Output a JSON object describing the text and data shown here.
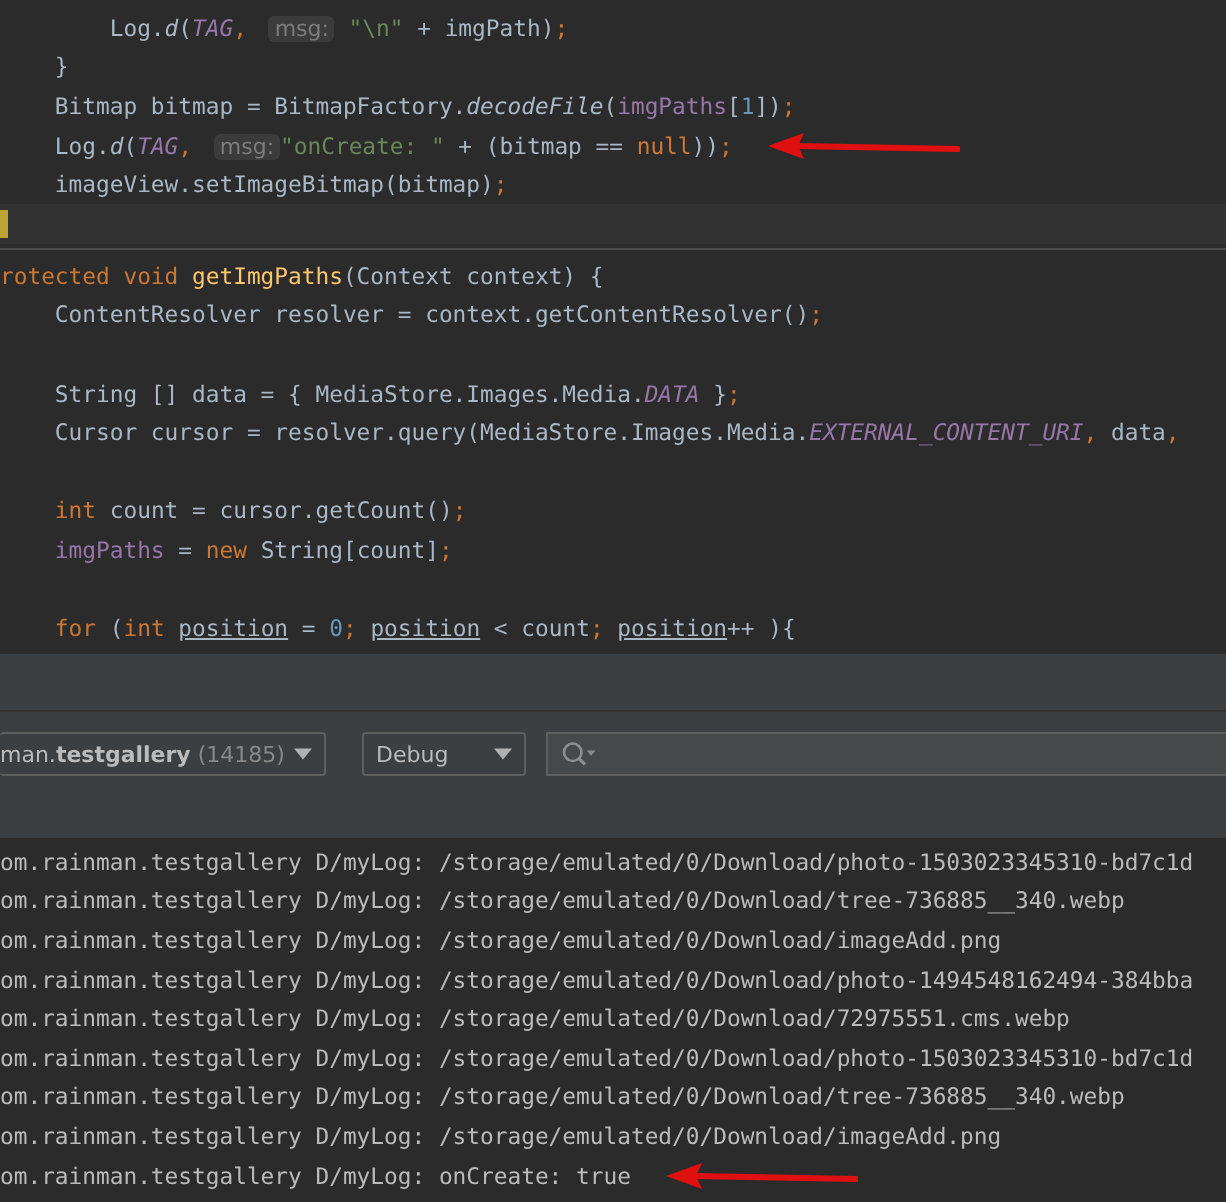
{
  "editor_top": {
    "lines": [
      {
        "marked": false,
        "current": false,
        "tokens": [
          {
            "text": "        Log.",
            "kind": "plain"
          },
          {
            "text": "d",
            "kind": "static_method"
          },
          {
            "text": "(",
            "kind": "plain"
          },
          {
            "text": "TAG",
            "kind": "static_field"
          },
          {
            "text": ", ",
            "kind": "keyword"
          },
          {
            "text": "msg:",
            "kind": "hint"
          },
          {
            "text": " \"\\n\"",
            "kind": "string"
          },
          {
            "text": " + imgPath)",
            "kind": "plain"
          },
          {
            "text": ";",
            "kind": "keyword"
          }
        ]
      },
      {
        "marked": false,
        "current": false,
        "tokens": [
          {
            "text": "    }",
            "kind": "plain"
          }
        ]
      },
      {
        "marked": false,
        "current": false,
        "tokens": [
          {
            "text": "    Bitmap bitmap = BitmapFactory.",
            "kind": "plain"
          },
          {
            "text": "decodeFile",
            "kind": "static_method"
          },
          {
            "text": "(",
            "kind": "plain"
          },
          {
            "text": "imgPaths",
            "kind": "field"
          },
          {
            "text": "[",
            "kind": "plain"
          },
          {
            "text": "1",
            "kind": "number"
          },
          {
            "text": "])",
            "kind": "plain"
          },
          {
            "text": ";",
            "kind": "keyword"
          }
        ]
      },
      {
        "marked": true,
        "current": false,
        "tokens": [
          {
            "text": "    Log.",
            "kind": "plain"
          },
          {
            "text": "d",
            "kind": "static_method"
          },
          {
            "text": "(",
            "kind": "plain"
          },
          {
            "text": "TAG",
            "kind": "static_field"
          },
          {
            "text": ", ",
            "kind": "keyword"
          },
          {
            "text": "msg:",
            "kind": "hint"
          },
          {
            "text": "\"onCreate: \"",
            "kind": "string"
          },
          {
            "text": " + (bitmap == ",
            "kind": "plain"
          },
          {
            "text": "null",
            "kind": "keyword"
          },
          {
            "text": "))",
            "kind": "plain"
          },
          {
            "text": ";",
            "kind": "keyword"
          }
        ]
      },
      {
        "marked": false,
        "current": false,
        "tokens": [
          {
            "text": "    imageView.setImageBitmap(bitmap)",
            "kind": "plain"
          },
          {
            "text": ";",
            "kind": "keyword"
          }
        ]
      },
      {
        "marked": false,
        "current": true
      }
    ]
  },
  "editor_bottom": {
    "lines": [
      {
        "marked": false,
        "current": false,
        "tokens": [
          {
            "text": "rotected void ",
            "kind": "keyword"
          },
          {
            "text": "getImgPaths",
            "kind": "declaration"
          },
          {
            "text": "(Context context) {",
            "kind": "plain"
          }
        ]
      },
      {
        "marked": false,
        "current": false,
        "tokens": [
          {
            "text": "    ContentResolver resolver = context.getContentResolver()",
            "kind": "plain"
          },
          {
            "text": ";",
            "kind": "keyword"
          }
        ]
      },
      {
        "marked": false,
        "current": false
      },
      {
        "marked": false,
        "current": false,
        "tokens": [
          {
            "text": "    String [] data = { MediaStore.Images.Media.",
            "kind": "plain"
          },
          {
            "text": "DATA",
            "kind": "static_field"
          },
          {
            "text": " }",
            "kind": "plain"
          },
          {
            "text": ";",
            "kind": "keyword"
          }
        ]
      },
      {
        "marked": false,
        "current": false,
        "tokens": [
          {
            "text": "    Cursor cursor = resolver.query(MediaStore.Images.Media.",
            "kind": "plain"
          },
          {
            "text": "EXTERNAL_CONTENT_URI",
            "kind": "static_field"
          },
          {
            "text": ", ",
            "kind": "keyword"
          },
          {
            "text": "data",
            "kind": "plain"
          },
          {
            "text": ",",
            "kind": "keyword"
          }
        ]
      },
      {
        "marked": false,
        "current": false
      },
      {
        "marked": false,
        "current": false,
        "tokens": [
          {
            "text": "    int ",
            "kind": "keyword"
          },
          {
            "text": "count = cursor.getCount()",
            "kind": "plain"
          },
          {
            "text": ";",
            "kind": "keyword"
          }
        ]
      },
      {
        "marked": false,
        "current": false,
        "tokens": [
          {
            "text": "    imgPaths",
            "kind": "field"
          },
          {
            "text": " = ",
            "kind": "plain"
          },
          {
            "text": "new ",
            "kind": "keyword"
          },
          {
            "text": "String[count]",
            "kind": "plain"
          },
          {
            "text": ";",
            "kind": "keyword"
          }
        ]
      },
      {
        "marked": false,
        "current": false
      },
      {
        "marked": false,
        "current": false,
        "tokens": [
          {
            "text": "    for ",
            "kind": "keyword"
          },
          {
            "text": "(",
            "kind": "plain"
          },
          {
            "text": "int ",
            "kind": "keyword"
          },
          {
            "text": "position",
            "kind": "variable"
          },
          {
            "text": " = ",
            "kind": "plain"
          },
          {
            "text": "0",
            "kind": "number"
          },
          {
            "text": "; ",
            "kind": "keyword"
          },
          {
            "text": "position",
            "kind": "variable"
          },
          {
            "text": " < count",
            "kind": "plain"
          },
          {
            "text": "; ",
            "kind": "keyword"
          },
          {
            "text": "position",
            "kind": "variable"
          },
          {
            "text": "++ ){",
            "kind": "plain"
          }
        ]
      }
    ]
  },
  "logcat_toolbar": {
    "process": {
      "prefix": "man.",
      "name": "testgallery",
      "pid": "(14185)"
    },
    "level": "Debug"
  },
  "logcat": {
    "lines": [
      {
        "marked": false,
        "text": "om.rainman.testgallery D/myLog: /storage/emulated/0/Download/photo-1503023345310-bd7c1d"
      },
      {
        "marked": false,
        "text": "om.rainman.testgallery D/myLog: /storage/emulated/0/Download/tree-736885__340.webp"
      },
      {
        "marked": false,
        "text": "om.rainman.testgallery D/myLog: /storage/emulated/0/Download/imageAdd.png"
      },
      {
        "marked": false,
        "text": "om.rainman.testgallery D/myLog: /storage/emulated/0/Download/photo-1494548162494-384bba"
      },
      {
        "marked": false,
        "text": "om.rainman.testgallery D/myLog: /storage/emulated/0/Download/72975551.cms.webp"
      },
      {
        "marked": false,
        "text": "om.rainman.testgallery D/myLog: /storage/emulated/0/Download/photo-1503023345310-bd7c1d"
      },
      {
        "marked": false,
        "text": "om.rainman.testgallery D/myLog: /storage/emulated/0/Download/tree-736885__340.webp"
      },
      {
        "marked": false,
        "text": "om.rainman.testgallery D/myLog: /storage/emulated/0/Download/imageAdd.png"
      },
      {
        "marked": true,
        "text": "om.rainman.testgallery D/myLog: onCreate: true"
      }
    ]
  }
}
